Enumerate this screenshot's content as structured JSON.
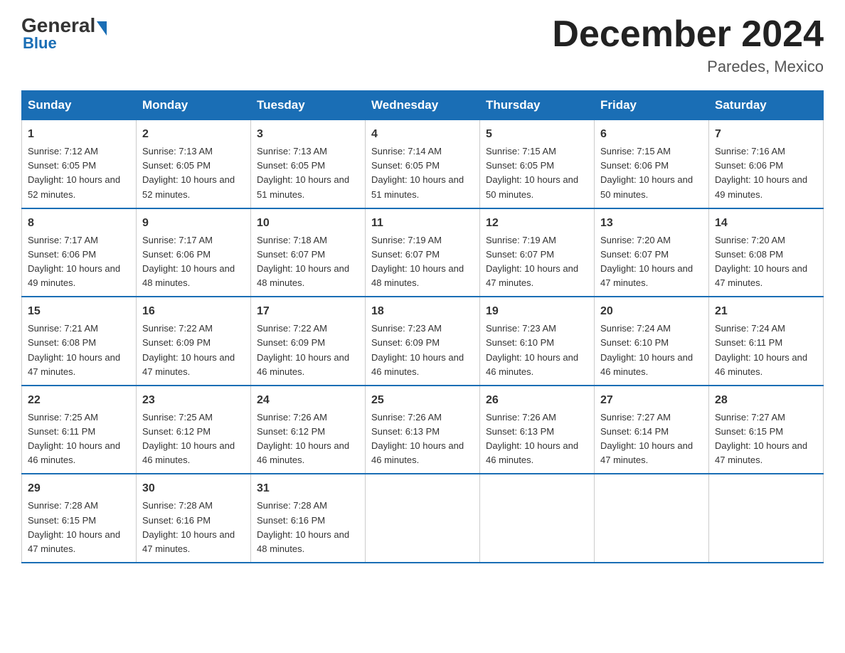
{
  "logo": {
    "general": "General",
    "blue": "Blue"
  },
  "title": "December 2024",
  "location": "Paredes, Mexico",
  "days_of_week": [
    "Sunday",
    "Monday",
    "Tuesday",
    "Wednesday",
    "Thursday",
    "Friday",
    "Saturday"
  ],
  "weeks": [
    [
      {
        "day": "1",
        "sunrise": "7:12 AM",
        "sunset": "6:05 PM",
        "daylight": "10 hours and 52 minutes."
      },
      {
        "day": "2",
        "sunrise": "7:13 AM",
        "sunset": "6:05 PM",
        "daylight": "10 hours and 52 minutes."
      },
      {
        "day": "3",
        "sunrise": "7:13 AM",
        "sunset": "6:05 PM",
        "daylight": "10 hours and 51 minutes."
      },
      {
        "day": "4",
        "sunrise": "7:14 AM",
        "sunset": "6:05 PM",
        "daylight": "10 hours and 51 minutes."
      },
      {
        "day": "5",
        "sunrise": "7:15 AM",
        "sunset": "6:05 PM",
        "daylight": "10 hours and 50 minutes."
      },
      {
        "day": "6",
        "sunrise": "7:15 AM",
        "sunset": "6:06 PM",
        "daylight": "10 hours and 50 minutes."
      },
      {
        "day": "7",
        "sunrise": "7:16 AM",
        "sunset": "6:06 PM",
        "daylight": "10 hours and 49 minutes."
      }
    ],
    [
      {
        "day": "8",
        "sunrise": "7:17 AM",
        "sunset": "6:06 PM",
        "daylight": "10 hours and 49 minutes."
      },
      {
        "day": "9",
        "sunrise": "7:17 AM",
        "sunset": "6:06 PM",
        "daylight": "10 hours and 48 minutes."
      },
      {
        "day": "10",
        "sunrise": "7:18 AM",
        "sunset": "6:07 PM",
        "daylight": "10 hours and 48 minutes."
      },
      {
        "day": "11",
        "sunrise": "7:19 AM",
        "sunset": "6:07 PM",
        "daylight": "10 hours and 48 minutes."
      },
      {
        "day": "12",
        "sunrise": "7:19 AM",
        "sunset": "6:07 PM",
        "daylight": "10 hours and 47 minutes."
      },
      {
        "day": "13",
        "sunrise": "7:20 AM",
        "sunset": "6:07 PM",
        "daylight": "10 hours and 47 minutes."
      },
      {
        "day": "14",
        "sunrise": "7:20 AM",
        "sunset": "6:08 PM",
        "daylight": "10 hours and 47 minutes."
      }
    ],
    [
      {
        "day": "15",
        "sunrise": "7:21 AM",
        "sunset": "6:08 PM",
        "daylight": "10 hours and 47 minutes."
      },
      {
        "day": "16",
        "sunrise": "7:22 AM",
        "sunset": "6:09 PM",
        "daylight": "10 hours and 47 minutes."
      },
      {
        "day": "17",
        "sunrise": "7:22 AM",
        "sunset": "6:09 PM",
        "daylight": "10 hours and 46 minutes."
      },
      {
        "day": "18",
        "sunrise": "7:23 AM",
        "sunset": "6:09 PM",
        "daylight": "10 hours and 46 minutes."
      },
      {
        "day": "19",
        "sunrise": "7:23 AM",
        "sunset": "6:10 PM",
        "daylight": "10 hours and 46 minutes."
      },
      {
        "day": "20",
        "sunrise": "7:24 AM",
        "sunset": "6:10 PM",
        "daylight": "10 hours and 46 minutes."
      },
      {
        "day": "21",
        "sunrise": "7:24 AM",
        "sunset": "6:11 PM",
        "daylight": "10 hours and 46 minutes."
      }
    ],
    [
      {
        "day": "22",
        "sunrise": "7:25 AM",
        "sunset": "6:11 PM",
        "daylight": "10 hours and 46 minutes."
      },
      {
        "day": "23",
        "sunrise": "7:25 AM",
        "sunset": "6:12 PM",
        "daylight": "10 hours and 46 minutes."
      },
      {
        "day": "24",
        "sunrise": "7:26 AM",
        "sunset": "6:12 PM",
        "daylight": "10 hours and 46 minutes."
      },
      {
        "day": "25",
        "sunrise": "7:26 AM",
        "sunset": "6:13 PM",
        "daylight": "10 hours and 46 minutes."
      },
      {
        "day": "26",
        "sunrise": "7:26 AM",
        "sunset": "6:13 PM",
        "daylight": "10 hours and 46 minutes."
      },
      {
        "day": "27",
        "sunrise": "7:27 AM",
        "sunset": "6:14 PM",
        "daylight": "10 hours and 47 minutes."
      },
      {
        "day": "28",
        "sunrise": "7:27 AM",
        "sunset": "6:15 PM",
        "daylight": "10 hours and 47 minutes."
      }
    ],
    [
      {
        "day": "29",
        "sunrise": "7:28 AM",
        "sunset": "6:15 PM",
        "daylight": "10 hours and 47 minutes."
      },
      {
        "day": "30",
        "sunrise": "7:28 AM",
        "sunset": "6:16 PM",
        "daylight": "10 hours and 47 minutes."
      },
      {
        "day": "31",
        "sunrise": "7:28 AM",
        "sunset": "6:16 PM",
        "daylight": "10 hours and 48 minutes."
      },
      null,
      null,
      null,
      null
    ]
  ]
}
